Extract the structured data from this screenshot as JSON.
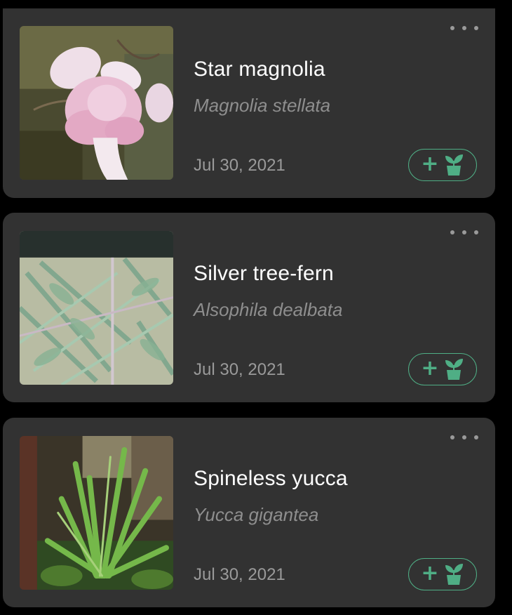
{
  "plants": [
    {
      "common_name": "Star magnolia",
      "scientific_name": "Magnolia stellata",
      "date": "Jul 30, 2021",
      "photo": "pink-magnolia-flower-photo"
    },
    {
      "common_name": "Silver tree-fern",
      "scientific_name": "Alsophila dealbata",
      "date": "Jul 30, 2021",
      "photo": "silver-fern-fronds-photo"
    },
    {
      "common_name": "Spineless yucca",
      "scientific_name": "Yucca gigantea",
      "date": "Jul 30, 2021",
      "photo": "yucca-plant-photo"
    }
  ],
  "icons": {
    "more": "more-dots-icon",
    "add": "plus-icon",
    "plant": "potted-plant-icon"
  },
  "colors": {
    "background": "#000000",
    "card": "#323232",
    "accent": "#4fae85",
    "title": "#ffffff",
    "secondary": "#9a9a9a"
  }
}
